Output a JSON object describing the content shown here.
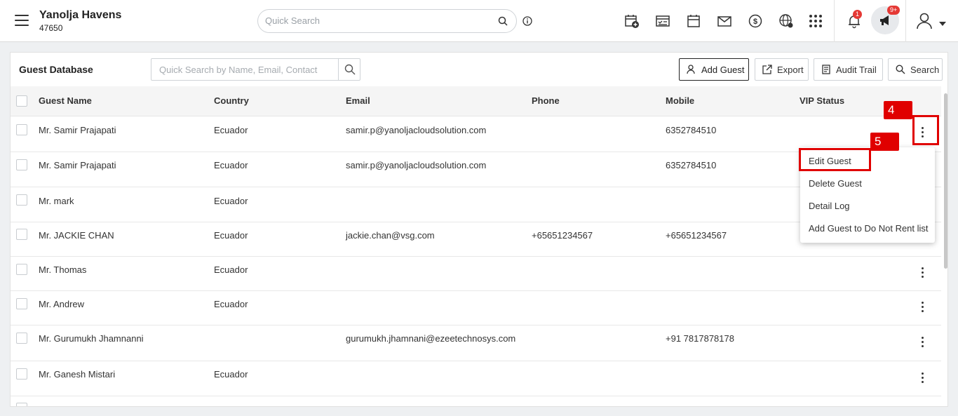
{
  "header": {
    "property_name": "Yanolja Havens",
    "property_id": "47650",
    "search_placeholder": "Quick Search",
    "notification_count": "1",
    "announcement_count": "9+",
    "icons": [
      "calendar-add-icon",
      "calendar-check-icon",
      "calendar-icon",
      "mail-icon",
      "dollar-icon",
      "globe-icon",
      "apps-grid-icon",
      "bell-icon",
      "megaphone-icon",
      "user-icon"
    ]
  },
  "panel": {
    "title": "Guest Database",
    "search_placeholder": "Quick Search by Name, Email, Contact",
    "buttons": {
      "add_guest": "Add Guest",
      "export": "Export",
      "audit_trail": "Audit Trail",
      "search": "Search"
    }
  },
  "table": {
    "columns": [
      "Guest Name",
      "Country",
      "Email",
      "Phone",
      "Mobile",
      "VIP Status"
    ],
    "rows": [
      {
        "name": "Mr. Samir Prajapati",
        "country": "Ecuador",
        "email": "samir.p@yanoljacloudsolution.com",
        "phone": "",
        "mobile": "6352784510",
        "vip": ""
      },
      {
        "name": "Mr. Samir Prajapati",
        "country": "Ecuador",
        "email": "samir.p@yanoljacloudsolution.com",
        "phone": "",
        "mobile": "6352784510",
        "vip": ""
      },
      {
        "name": "Mr. mark",
        "country": "Ecuador",
        "email": "",
        "phone": "",
        "mobile": "",
        "vip": ""
      },
      {
        "name": "Mr. JACKIE CHAN",
        "country": "Ecuador",
        "email": "jackie.chan@vsg.com",
        "phone": "+65651234567",
        "mobile": "+65651234567",
        "vip": ""
      },
      {
        "name": "Mr. Thomas",
        "country": "Ecuador",
        "email": "",
        "phone": "",
        "mobile": "",
        "vip": ""
      },
      {
        "name": "Mr. Andrew",
        "country": "Ecuador",
        "email": "",
        "phone": "",
        "mobile": "",
        "vip": ""
      },
      {
        "name": "Mr. Gurumukh Jhamnanni",
        "country": "",
        "email": "gurumukh.jhamnani@ezeetechnosys.com",
        "phone": "",
        "mobile": "+91 7817878178",
        "vip": ""
      },
      {
        "name": "Mr. Ganesh Mistari",
        "country": "Ecuador",
        "email": "",
        "phone": "",
        "mobile": "",
        "vip": ""
      }
    ]
  },
  "context_menu": {
    "items": [
      "Edit Guest",
      "Delete Guest",
      "Detail Log",
      "Add Guest to Do Not Rent list"
    ]
  },
  "annotations": {
    "step_4": "4",
    "step_5": "5",
    "highlight_color": "#e00000"
  }
}
